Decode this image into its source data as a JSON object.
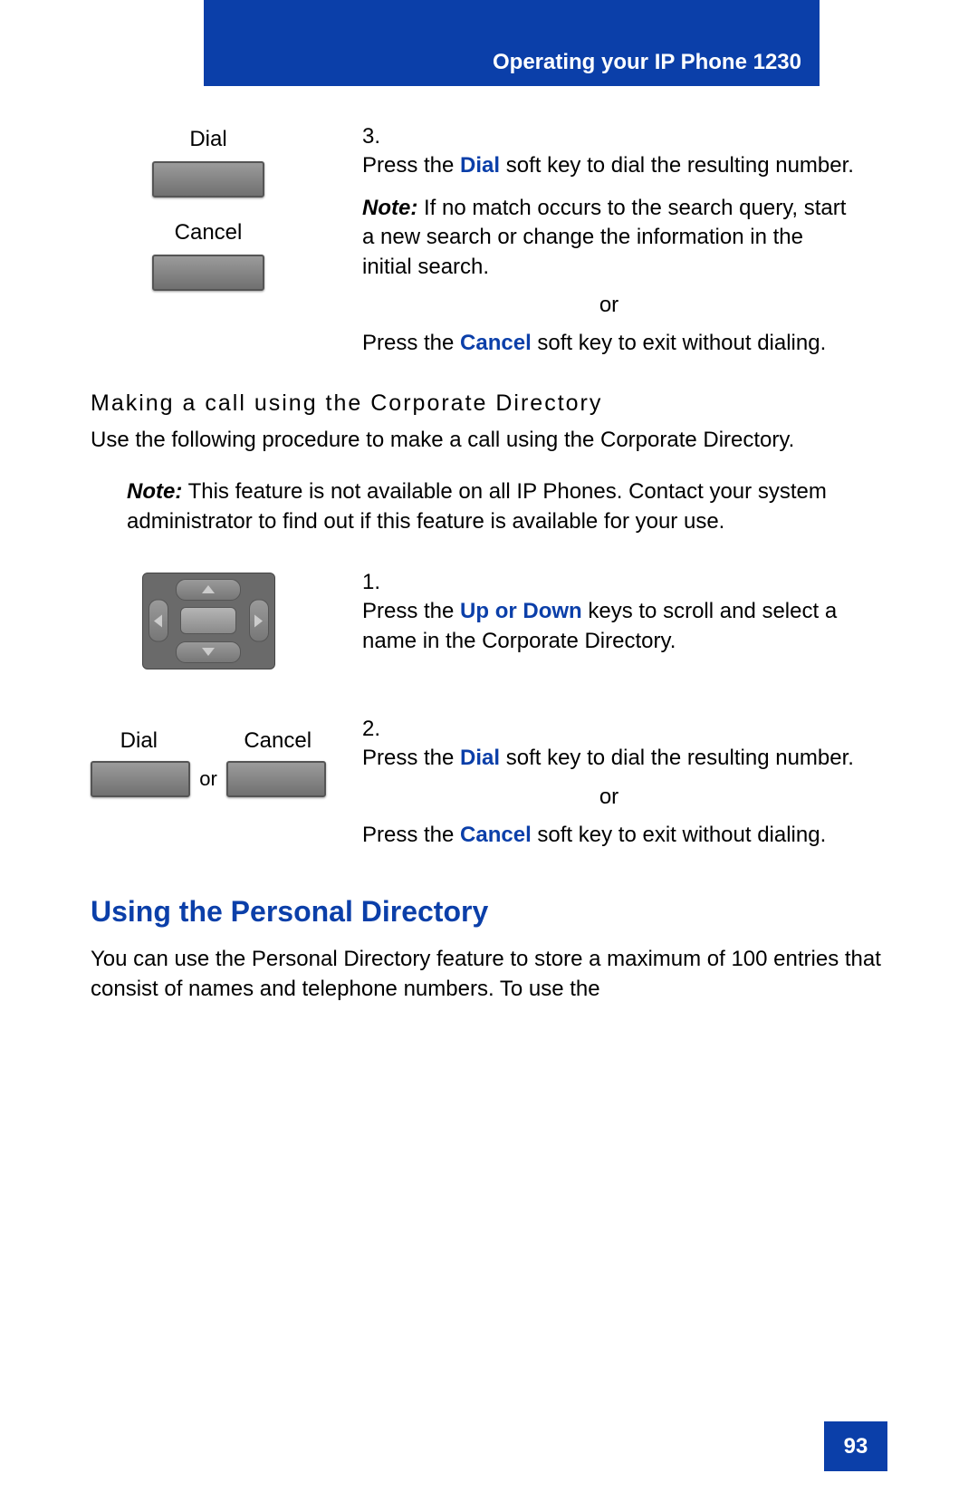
{
  "header": {
    "title": "Operating your IP Phone 1230"
  },
  "step3": {
    "left": {
      "dial_label": "Dial",
      "cancel_label": "Cancel"
    },
    "num": "3.",
    "line1a": "Press the ",
    "kw1": "Dial",
    "line1b": " soft key to dial the resulting number.",
    "note_label": "Note:",
    "note_text": " If no match occurs to the search query, start a new search or change the information in the initial search.",
    "or": "or",
    "line2a": "Press the ",
    "kw2": "Cancel",
    "line2b": " soft key to exit without dialing."
  },
  "corp": {
    "title": "Making a call using the Corporate Directory",
    "intro": "Use the following procedure to make a call using the Corporate Directory.",
    "note_label": "Note:",
    "note_text": " This feature is not available on all IP Phones. Contact your system administrator to find out if this feature is available for your use."
  },
  "cstep1": {
    "num": "1.",
    "a": "Press the ",
    "kw": "Up or Down",
    "b": " keys to scroll and select a name in the Corporate Directory."
  },
  "cstep2": {
    "left": {
      "dial_label": "Dial",
      "cancel_label": "Cancel",
      "or": "or"
    },
    "num": "2.",
    "line1a": "Press the ",
    "kw1": "Dial",
    "line1b": " soft key to dial the resulting number.",
    "or": "or",
    "line2a": "Press the ",
    "kw2": "Cancel",
    "line2b": " soft key to exit without dialing."
  },
  "personal": {
    "heading": "Using the Personal Directory",
    "body": "You can use the Personal Directory feature to store a maximum of 100 entries that consist of names and telephone numbers. To use the"
  },
  "page_number": "93"
}
